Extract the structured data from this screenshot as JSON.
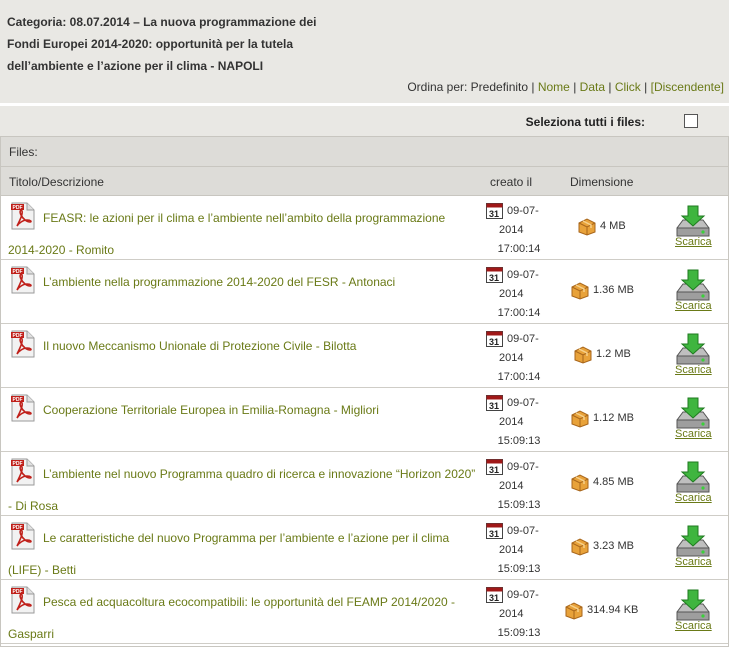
{
  "category": {
    "title": "Categoria: 08.07.2014 – La nuova programmazione dei Fondi Europei 2014-2020: opportunità per la tutela dell’ambiente e l’azione per il clima - NAPOLI"
  },
  "sort": {
    "prefix": "Ordina per: Predefinito |",
    "options": [
      "Nome",
      "Data",
      "Click",
      "[Discendente]"
    ]
  },
  "select_all_label": "Seleziona tutti i files:",
  "files_label": "Files:",
  "columns": {
    "title": "Titolo/Descrizione",
    "created": "creato il",
    "size": "Dimensione"
  },
  "download_label": "Scarica",
  "files": [
    {
      "title": "FEASR: le azioni per il clima e l’ambiente nell’ambito della programmazione 2014-2020 - Romito",
      "date": "09-07-2014",
      "time": "17:00:14",
      "size": "4 MB"
    },
    {
      "title": "L’ambiente nella programmazione 2014-2020 del FESR - Antonaci",
      "date": "09-07-2014",
      "time": "17:00:14",
      "size": "1.36 MB"
    },
    {
      "title": "Il nuovo Meccanismo Unionale di Protezione Civile - Bilotta",
      "date": "09-07-2014",
      "time": "17:00:14",
      "size": "1.2 MB"
    },
    {
      "title": "Cooperazione Territoriale Europea in Emilia-Romagna - Migliori",
      "date": "09-07-2014",
      "time": "15:09:13",
      "size": "1.12 MB"
    },
    {
      "title": "L’ambiente nel nuovo Programma quadro di ricerca e innovazione “Horizon 2020” - Di Rosa",
      "date": "09-07-2014",
      "time": "15:09:13",
      "size": "4.85 MB"
    },
    {
      "title": "Le caratteristiche del nuovo Programma per l’ambiente e l’azione per il clima (LIFE) - Betti",
      "date": "09-07-2014",
      "time": "15:09:13",
      "size": "3.23 MB"
    },
    {
      "title": "Pesca ed acquacoltura ecocompatibili: le opportunità del FEAMP 2014/2020 - Gasparri",
      "date": "09-07-2014",
      "time": "15:09:13",
      "size": "314.94 KB"
    }
  ],
  "icons": {
    "file": "pdf-icon",
    "date": "calendar-icon",
    "size": "package-icon",
    "download": "download-drive-icon"
  },
  "colors": {
    "link": "#6a7a17",
    "header_bg": "#e9e8e4",
    "table_header_bg": "#dddcd8"
  }
}
